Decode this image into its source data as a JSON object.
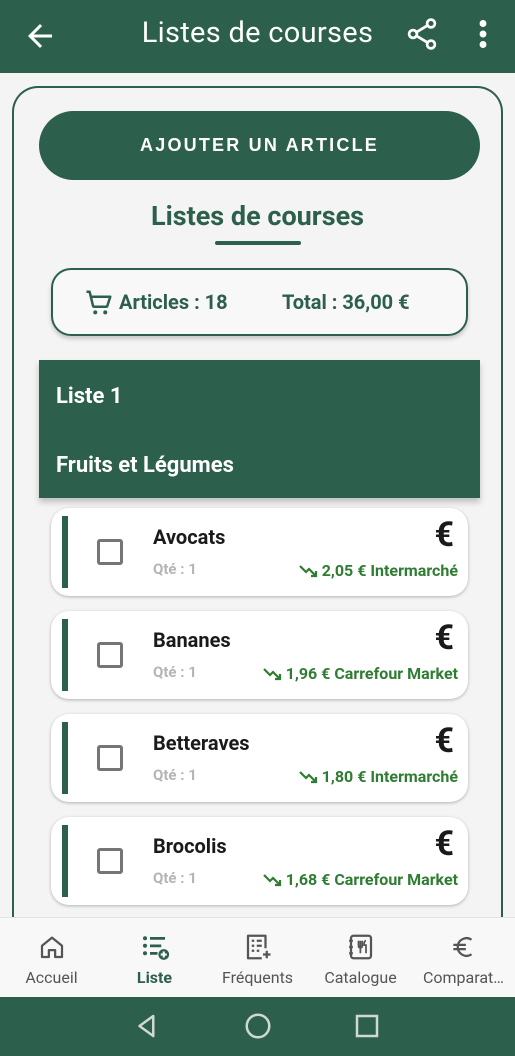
{
  "appbar": {
    "title": "Listes de courses",
    "icons": [
      "back-arrow-icon",
      "share-icon",
      "more-vertical-icon"
    ]
  },
  "add_button": {
    "label": "AJOUTER UN ARTICLE"
  },
  "section": {
    "title": "Listes de courses"
  },
  "summary": {
    "articles_label": "Articles : 18",
    "total_label": "Total : 36,00 €"
  },
  "group": {
    "list_name": "Liste 1",
    "category": "Fruits et Légumes"
  },
  "items": [
    {
      "name": "Avocats",
      "qty": "Qté : 1",
      "price": "2,05 € Intermarché",
      "currency_icon": "€"
    },
    {
      "name": "Bananes",
      "qty": "Qté : 1",
      "price": "1,96 € Carrefour Market",
      "currency_icon": "€"
    },
    {
      "name": "Betteraves",
      "qty": "Qté : 1",
      "price": "1,80 € Intermarché",
      "currency_icon": "€"
    },
    {
      "name": "Brocolis",
      "qty": "Qté : 1",
      "price": "1,68 € Carrefour Market",
      "currency_icon": "€"
    }
  ],
  "nav": {
    "items": [
      {
        "label": "Accueil",
        "icon": "home-icon"
      },
      {
        "label": "Liste",
        "icon": "list-add-icon",
        "active": true
      },
      {
        "label": "Fréquents",
        "icon": "frequent-list-icon"
      },
      {
        "label": "Catalogue",
        "icon": "catalogue-icon"
      },
      {
        "label": "Comparat…",
        "icon": "euro-icon"
      }
    ]
  },
  "colors": {
    "primary": "#2c5f4c",
    "price_green": "#2e7d32",
    "background": "#f3f4f3"
  }
}
